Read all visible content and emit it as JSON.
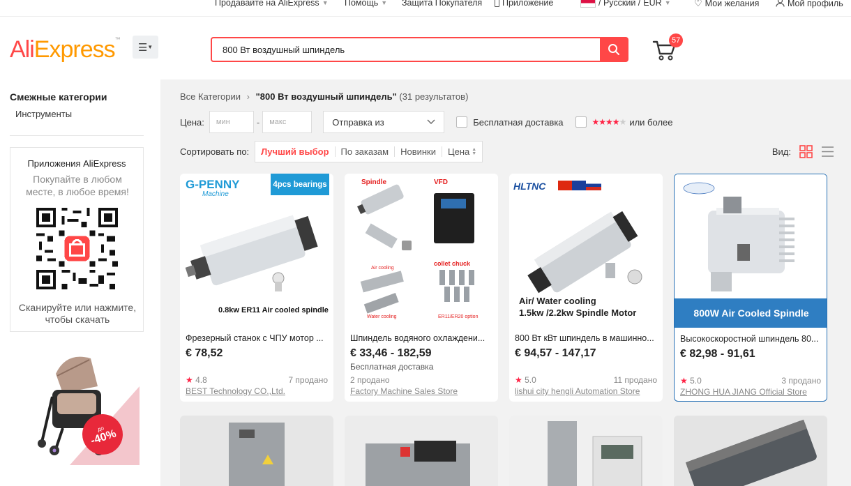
{
  "topbar": {
    "sell": "Продавайте на AliExpress",
    "help": "Помощь",
    "protection": "Защита Покупателя",
    "app": "Приложение",
    "locale": "/ Русский /",
    "currency": "EUR",
    "wishlist": "Мои желания",
    "profile": "Мой профиль"
  },
  "header": {
    "logo_ali": "Ali",
    "logo_express": "Express",
    "logo_tm": "™",
    "search_value": "800 Вт воздушный шпиндель",
    "cart_count": "57"
  },
  "sidebar": {
    "related_title": "Смежные категории",
    "related_items": [
      "Инструменты"
    ],
    "app_title": "Приложения AliExpress",
    "app_subtitle": "Покупайте в любом месте, в любое время!",
    "app_scan": "Сканируйте или нажмите, чтобы скачать",
    "promo_prefix": "до",
    "promo_discount": "-40%"
  },
  "main": {
    "breadcrumb_root": "Все Категории",
    "breadcrumb_query": "\"800 Вт воздушный шпиндель\"",
    "breadcrumb_count": "(31 результатов)",
    "price_label": "Цена:",
    "price_min_placeholder": "мин",
    "price_max_placeholder": "макс",
    "ship_from": "Отправка из",
    "free_shipping": "Бесплатная доставка",
    "rating_or_more": "или более",
    "sort_label": "Сортировать по:",
    "sort_options": [
      "Лучший выбор",
      "По заказам",
      "Новинки",
      "Цена"
    ],
    "view_label": "Вид:",
    "accent_color": "#ff4747"
  },
  "products": [
    {
      "title": "Фрезерный станок с ЧПУ мотор ...",
      "price": "€ 78,52",
      "shipping": "",
      "rating": "4.8",
      "sold": "7 продано",
      "store": "BEST Technology CO.,Ltd.",
      "img_brand": "G-PENNY",
      "img_brand_sub": "Machine",
      "img_tag": "4pcs bearings",
      "img_caption": "0.8kw ER11  Air cooled spindle"
    },
    {
      "title": "Шпиндель водяного охлаждени...",
      "price": "€ 33,46 - 182,59",
      "shipping": "Бесплатная доставка",
      "rating": "",
      "sold": "2 продано",
      "store": "Factory Machine Sales Store",
      "img_spindle": "Spindle",
      "img_vfd": "VFD",
      "img_air": "Air cooling",
      "img_collet": "collet chuck",
      "img_water": "Water cooling",
      "img_er": "ER11/ER20 option"
    },
    {
      "title": "800 Вт кВт шпиндель в машинно...",
      "price": "€ 94,57 - 147,17",
      "shipping": "",
      "rating": "5.0",
      "sold": "11 продано",
      "store": "lishui city hengli Automation Store",
      "img_brand": "HLTNC",
      "img_line1": "Air/ Water cooling",
      "img_line2": "1.5kw /2.2kw  Spindle Motor"
    },
    {
      "title": "Высокоскоростной шпиндель 80...",
      "price": "€ 82,98 - 91,61",
      "shipping": "",
      "rating": "5.0",
      "sold": "3 продано",
      "store": "ZHONG HUA JIANG Official Store",
      "img_banner": "800W Air Cooled Spindle"
    }
  ]
}
